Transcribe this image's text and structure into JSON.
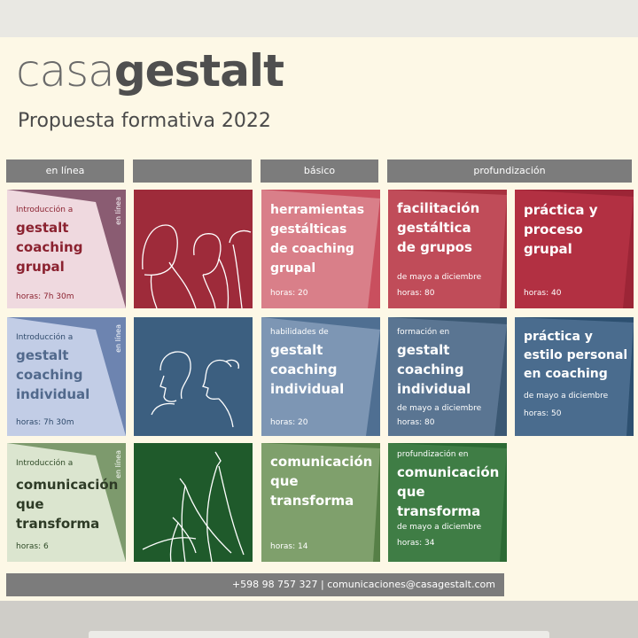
{
  "brand": {
    "part1": "casa",
    "part2": "gestalt"
  },
  "subtitle": "Propuesta formativa 2022",
  "headers": [
    "en línea",
    "básico",
    "profundización"
  ],
  "online": [
    {
      "intro": "Introducción a",
      "title_lines": [
        "gestalt",
        "coaching",
        "grupal"
      ],
      "hours": "horas: 7h 30m",
      "tag": "en línea"
    },
    {
      "intro": "Introducción a",
      "title_lines": [
        "gestalt",
        "coaching",
        "individual"
      ],
      "hours": "horas: 7h 30m",
      "tag": "en línea"
    },
    {
      "intro": "Introducción a",
      "title_lines": [
        "comunicación",
        "que",
        "transforma"
      ],
      "hours": "horas: 6",
      "tag": "en línea"
    }
  ],
  "basico": [
    {
      "intro": "",
      "title_lines": [
        "herramientas",
        "gestálticas",
        "de coaching",
        "grupal"
      ],
      "hours": "horas: 20"
    },
    {
      "intro": "habilidades de",
      "title_lines": [
        "gestalt",
        "coaching",
        "individual"
      ],
      "hours": "horas: 20"
    },
    {
      "intro": "",
      "title_lines": [
        "comunicación",
        "que",
        "transforma"
      ],
      "hours": "horas: 14"
    }
  ],
  "profundizacion": [
    {
      "intro": "",
      "title_lines": [
        "facilitación",
        "gestáltica",
        "de grupos"
      ],
      "dates": "de mayo a diciembre",
      "hours": "horas: 80"
    },
    {
      "intro": "formación en",
      "title_lines": [
        "gestalt",
        "coaching",
        "individual"
      ],
      "dates": "de mayo a diciembre",
      "hours": "horas: 80"
    },
    {
      "intro": "profundización en",
      "title_lines": [
        "comunicación",
        "que",
        "transforma"
      ],
      "dates": "de mayo a diciembre",
      "hours": "horas: 34"
    }
  ],
  "extra": [
    {
      "title_lines": [
        "práctica y",
        "proceso",
        "grupal"
      ],
      "dates": "",
      "hours": "horas: 40"
    },
    {
      "title_lines": [
        "práctica y",
        "estilo personal",
        "en coaching"
      ],
      "dates": "de mayo a diciembre",
      "hours": "horas: 50"
    }
  ],
  "footer": "+598 98 757 327  |  comunicaciones@casagestalt.com",
  "colors": {
    "burgundy": "#9e2b3a",
    "blue": "#3c5f80",
    "green": "#2f6a3a",
    "grey": "#7c7c7c"
  }
}
